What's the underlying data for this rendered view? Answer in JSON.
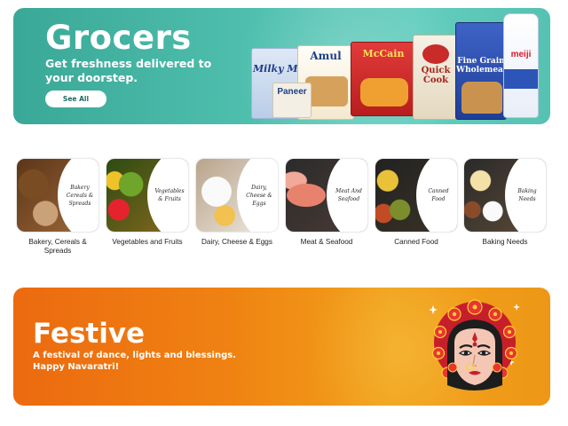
{
  "grocers_banner": {
    "title": "Grocers",
    "subtitle": "Get freshness delivered to your doorstep.",
    "cta_label": "See All",
    "products": [
      {
        "name": "milky-mist",
        "label": "Milky Mist"
      },
      {
        "name": "paneer",
        "label": "Paneer"
      },
      {
        "name": "amul",
        "label": "Amul"
      },
      {
        "name": "mccain",
        "label": "McCain"
      },
      {
        "name": "quick-cook",
        "label": "Quick Cook"
      },
      {
        "name": "wholemeal-bread",
        "label": "Fine Grain Wholemeal"
      },
      {
        "name": "meiji-milk",
        "label": "meiji"
      }
    ]
  },
  "categories": [
    {
      "name": "Bakery, Cereals & Spreads",
      "tag": "Bakery Cereals & Spreads"
    },
    {
      "name": "Vegetables and Fruits",
      "tag": "Vegetables & Fruits"
    },
    {
      "name": "Dairy, Cheese & Eggs",
      "tag": "Dairy, Cheese & Eggs"
    },
    {
      "name": "Meat & Seafood",
      "tag": "Meat And Seafood"
    },
    {
      "name": "Canned Food",
      "tag": "Canned Food"
    },
    {
      "name": "Baking Needs",
      "tag": "Baking Needs"
    }
  ],
  "festive_banner": {
    "title": "Festive",
    "subtitle": "A festival of dance, lights and blessings. Happy Navaratri!"
  },
  "colors": {
    "grocers_bg": "#4fbfae",
    "festive_bg": "#ef8212",
    "cta_text": "#1d6b60"
  }
}
